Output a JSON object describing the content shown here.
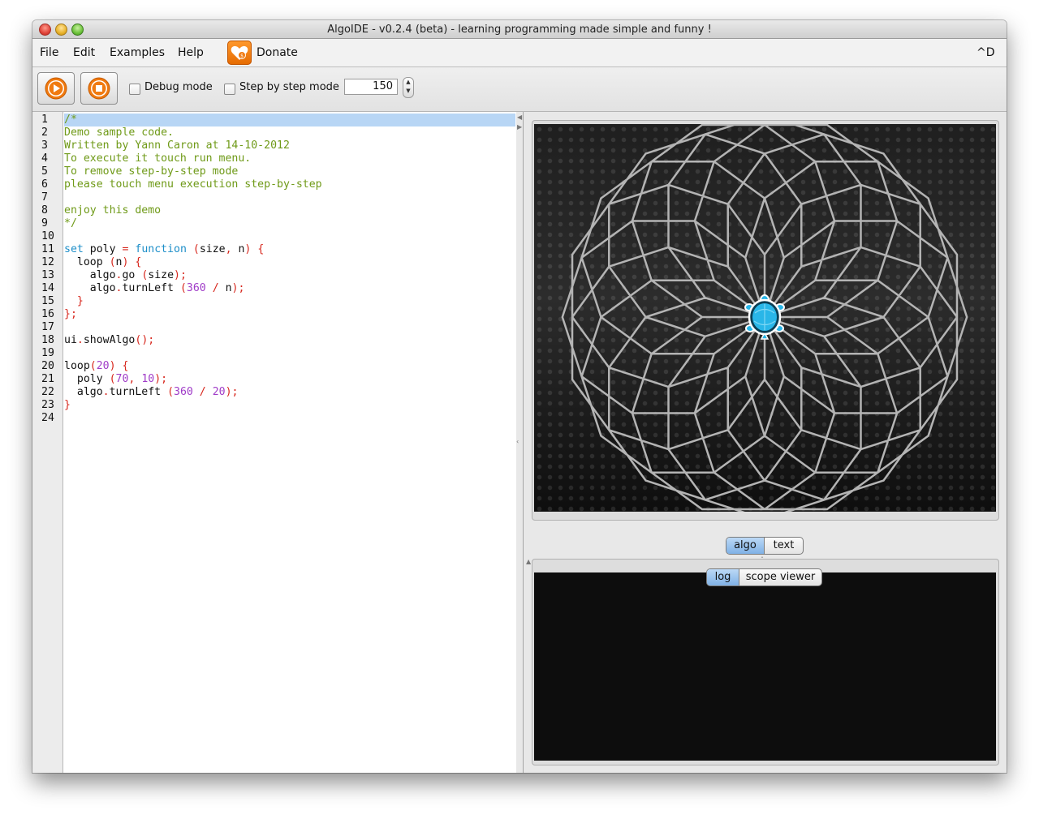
{
  "window": {
    "title": "AlgoIDE - v0.2.4 (beta) - learning programming made simple and funny !"
  },
  "menu": {
    "file": "File",
    "edit": "Edit",
    "examples": "Examples",
    "help": "Help",
    "donate": "Donate",
    "shortcut": "^D"
  },
  "toolbar": {
    "run_icon": "play-icon",
    "stop_icon": "stop-icon",
    "debug_label": "Debug mode",
    "debug_checked": false,
    "step_label": "Step by step mode",
    "step_checked": false,
    "speed_value": "150"
  },
  "editor": {
    "line_numbers": [
      "1",
      "2",
      "3",
      "4",
      "5",
      "6",
      "7",
      "8",
      "9",
      "10",
      "11",
      "12",
      "13",
      "14",
      "15",
      "16",
      "17",
      "18",
      "19",
      "20",
      "21",
      "22",
      "23",
      "24"
    ],
    "highlighted_line": 1,
    "lines": [
      [
        [
          "cm",
          "/*"
        ]
      ],
      [
        [
          "cm",
          "Demo sample code."
        ]
      ],
      [
        [
          "cm",
          "Written by Yann Caron at 14-10-2012"
        ]
      ],
      [
        [
          "cm",
          "To execute it touch run menu."
        ]
      ],
      [
        [
          "cm",
          "To remove step-by-step mode"
        ]
      ],
      [
        [
          "cm",
          "please touch menu execution step-by-step"
        ]
      ],
      [],
      [
        [
          "cm",
          "enjoy this demo"
        ]
      ],
      [
        [
          "cm",
          "*/"
        ]
      ],
      [],
      [
        [
          "kw",
          "set"
        ],
        [
          "id",
          " poly "
        ],
        [
          "pu",
          "="
        ],
        [
          "id",
          " "
        ],
        [
          "kw",
          "function"
        ],
        [
          "id",
          " "
        ],
        [
          "pu",
          "("
        ],
        [
          "id",
          "size"
        ],
        [
          "pu",
          ","
        ],
        [
          "id",
          " n"
        ],
        [
          "pu",
          ")"
        ],
        [
          "id",
          " "
        ],
        [
          "pu",
          "{"
        ]
      ],
      [
        [
          "id",
          "  loop "
        ],
        [
          "pu",
          "("
        ],
        [
          "id",
          "n"
        ],
        [
          "pu",
          ")"
        ],
        [
          "id",
          " "
        ],
        [
          "pu",
          "{"
        ]
      ],
      [
        [
          "id",
          "    algo"
        ],
        [
          "pu",
          "."
        ],
        [
          "id",
          "go "
        ],
        [
          "pu",
          "("
        ],
        [
          "id",
          "size"
        ],
        [
          "pu",
          ")"
        ],
        [
          "pu",
          ";"
        ]
      ],
      [
        [
          "id",
          "    algo"
        ],
        [
          "pu",
          "."
        ],
        [
          "id",
          "turnLeft "
        ],
        [
          "pu",
          "("
        ],
        [
          "nu",
          "360"
        ],
        [
          "id",
          " "
        ],
        [
          "pu",
          "/"
        ],
        [
          "id",
          " n"
        ],
        [
          "pu",
          ")"
        ],
        [
          "pu",
          ";"
        ]
      ],
      [
        [
          "id",
          "  "
        ],
        [
          "pu",
          "}"
        ]
      ],
      [
        [
          "pu",
          "}"
        ],
        [
          "pu",
          ";"
        ]
      ],
      [],
      [
        [
          "id",
          "ui"
        ],
        [
          "pu",
          "."
        ],
        [
          "id",
          "showAlgo"
        ],
        [
          "pu",
          "()"
        ],
        [
          "pu",
          ";"
        ]
      ],
      [],
      [
        [
          "id",
          "loop"
        ],
        [
          "pu",
          "("
        ],
        [
          "nu",
          "20"
        ],
        [
          "pu",
          ")"
        ],
        [
          "id",
          " "
        ],
        [
          "pu",
          "{"
        ]
      ],
      [
        [
          "id",
          "  poly "
        ],
        [
          "pu",
          "("
        ],
        [
          "nu",
          "70"
        ],
        [
          "pu",
          ","
        ],
        [
          "id",
          " "
        ],
        [
          "nu",
          "10"
        ],
        [
          "pu",
          ")"
        ],
        [
          "pu",
          ";"
        ]
      ],
      [
        [
          "id",
          "  algo"
        ],
        [
          "pu",
          "."
        ],
        [
          "id",
          "turnLeft "
        ],
        [
          "pu",
          "("
        ],
        [
          "nu",
          "360"
        ],
        [
          "id",
          " "
        ],
        [
          "pu",
          "/"
        ],
        [
          "id",
          " "
        ],
        [
          "nu",
          "20"
        ],
        [
          "pu",
          ")"
        ],
        [
          "pu",
          ";"
        ]
      ],
      [
        [
          "pu",
          "}"
        ]
      ],
      []
    ]
  },
  "canvas": {
    "drawing": {
      "loops": 20,
      "polygon_sides": 10,
      "side_length": 70,
      "stroke_color": "#b4b4b4"
    },
    "turtle_icon": "turtle-icon",
    "turtle_color": "#29b6e8"
  },
  "view_tabs": {
    "algo": "algo",
    "text": "text",
    "selected": "algo"
  },
  "output_tabs": {
    "log": "log",
    "scope_viewer": "scope viewer",
    "selected": "log"
  },
  "colors": {
    "comment": "#6f9a18",
    "keyword": "#1e8fc9",
    "punctuation": "#d7261c",
    "number": "#a03cc8",
    "accent_orange": "#f07a10"
  }
}
